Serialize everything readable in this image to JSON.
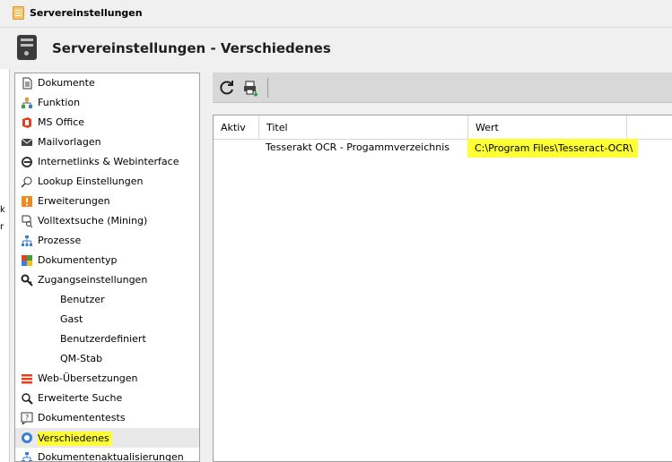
{
  "window": {
    "title": "Servereinstellungen"
  },
  "header": {
    "title": "Servereinstellungen - Verschiedenes"
  },
  "left_edge_fragments": [
    "k",
    "r"
  ],
  "tree": {
    "items": [
      {
        "label": "Dokumente",
        "icon": "document-icon"
      },
      {
        "label": "Funktion",
        "icon": "function-tree-icon"
      },
      {
        "label": "MS Office",
        "icon": "ms-office-icon"
      },
      {
        "label": "Mailvorlagen",
        "icon": "mail-template-icon"
      },
      {
        "label": "Internetlinks & Webinterface",
        "icon": "internet-explorer-icon"
      },
      {
        "label": "Lookup Einstellungen",
        "icon": "lookup-magnifier-icon"
      },
      {
        "label": "Erweiterungen",
        "icon": "extension-icon"
      },
      {
        "label": "Volltextsuche (Mining)",
        "icon": "fulltext-search-icon"
      },
      {
        "label": "Prozesse",
        "icon": "process-tree-icon"
      },
      {
        "label": "Dokumententyp",
        "icon": "document-type-icon"
      },
      {
        "label": "Zugangseinstellungen",
        "icon": "key-icon"
      },
      {
        "label": "Benutzer",
        "child": true
      },
      {
        "label": "Gast",
        "child": true
      },
      {
        "label": "Benutzerdefiniert",
        "child": true
      },
      {
        "label": "QM-Stab",
        "child": true
      },
      {
        "label": "Web-Übersetzungen",
        "icon": "translation-icon"
      },
      {
        "label": "Erweiterte Suche",
        "icon": "advanced-search-icon"
      },
      {
        "label": "Dokumententests",
        "icon": "document-test-icon"
      },
      {
        "label": "Verschiedenes",
        "icon": "misc-info-icon",
        "selected": true
      },
      {
        "label": "Dokumentenaktualisierungen",
        "icon": "document-update-icon"
      }
    ]
  },
  "toolbar": {
    "refresh_icon": "refresh-icon",
    "export_icon": "export-icon"
  },
  "grid": {
    "columns": [
      "Aktiv",
      "Titel",
      "Wert"
    ],
    "rows": [
      {
        "aktiv": "",
        "titel": "Tesserakt OCR - Progammverzeichnis",
        "wert": "C:\\Program Files\\Tesseract-OCR\\"
      }
    ]
  },
  "colors": {
    "highlight": "#ffff33",
    "accent_blue": "#3a7fd5",
    "selected_row": "#e9e9e9"
  }
}
